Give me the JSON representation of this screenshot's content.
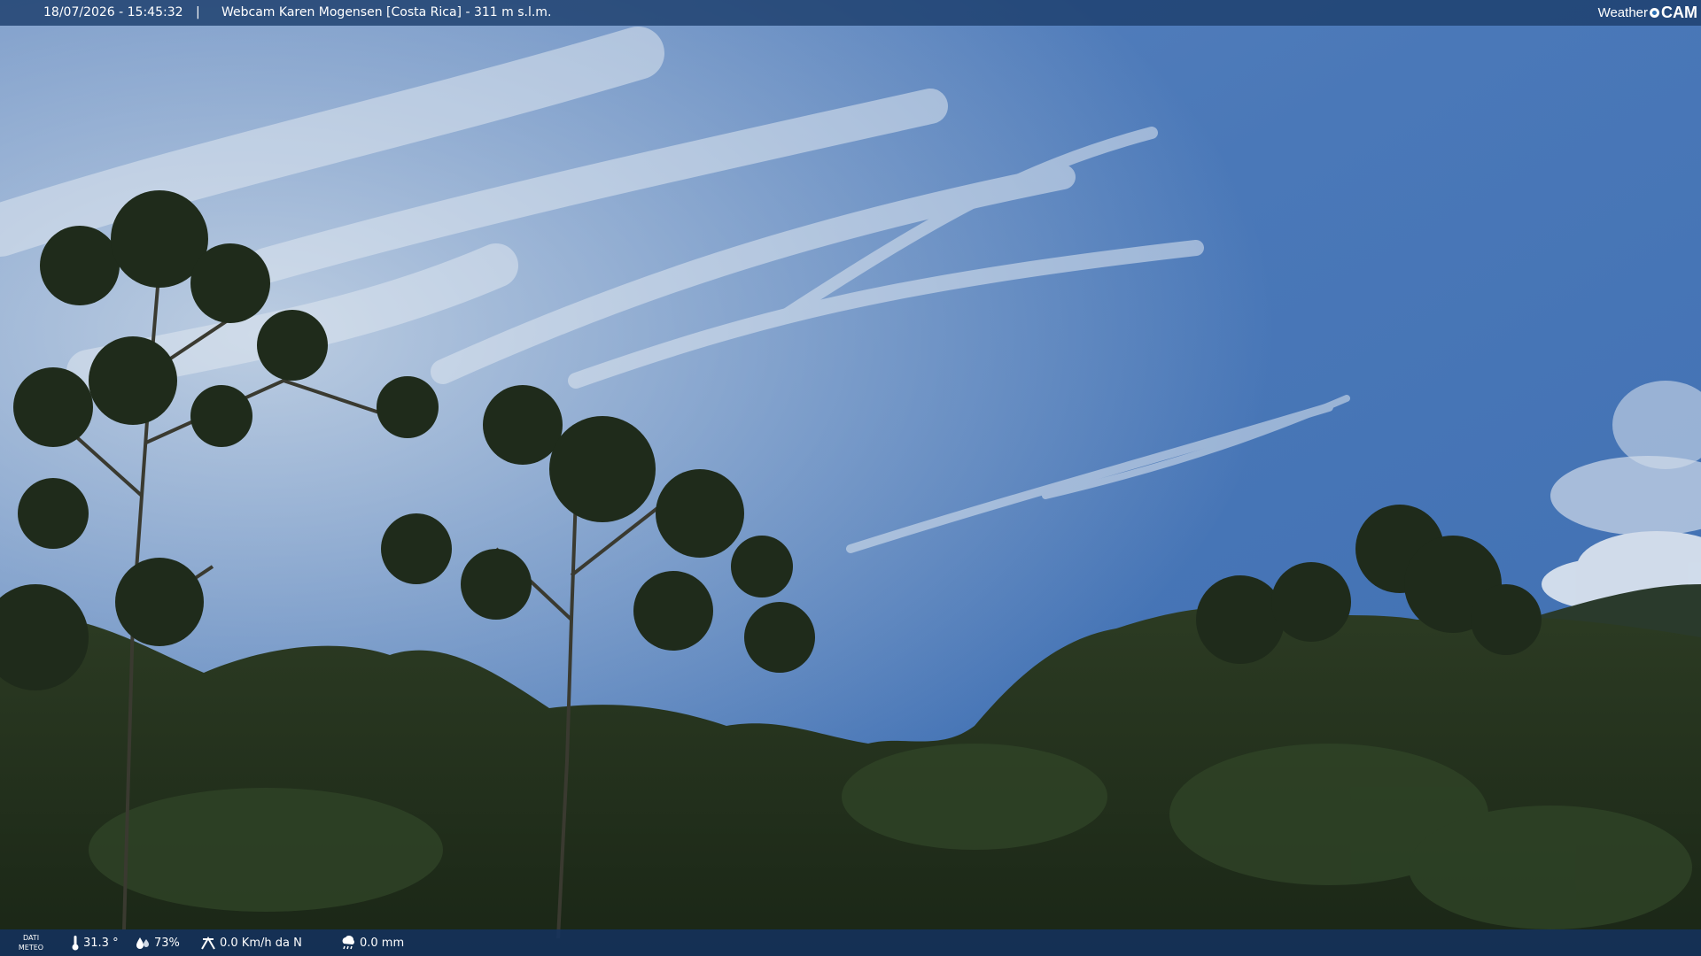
{
  "overlay": {
    "datetime": "18/07/2026 - 15:45:32",
    "separator": "|",
    "title": "Webcam Karen Mogensen [Costa Rica] - 311 m s.l.m.",
    "brand_prefix": "Weather",
    "brand_suffix": "CAM"
  },
  "weather": {
    "label_line1": "DATI",
    "label_line2": "METEO",
    "temperature": "31.3 °",
    "humidity": "73%",
    "wind": "0.0 Km/h da N",
    "rain": "0.0 mm",
    "icons": [
      "thermometer-icon",
      "humidity-icon",
      "wind-icon",
      "rain-icon"
    ]
  },
  "colors": {
    "sky_top": "#3f6aa6",
    "sky_bottom": "#6f9ad0",
    "forest_dark": "#1d2a1a",
    "bar": "#1c3e6c"
  }
}
